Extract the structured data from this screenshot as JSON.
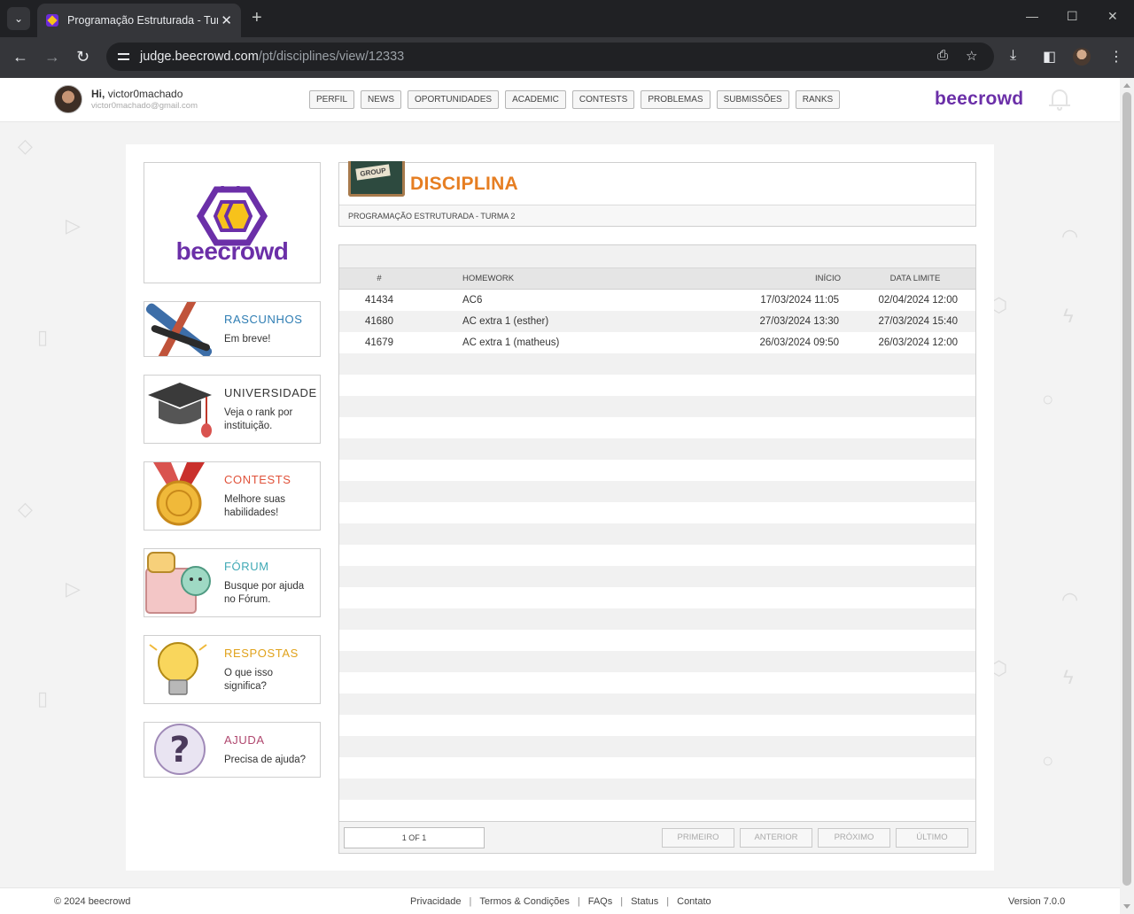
{
  "browser": {
    "tab_title": "Programação Estruturada - Turma 2",
    "url_host": "judge.beecrowd.com",
    "url_path": "/pt/disciplines/view/12333"
  },
  "header": {
    "greeting": "Hi,",
    "username": "victor0machado",
    "email": "victor0machado@gmail.com",
    "nav": [
      "PERFIL",
      "NEWS",
      "OPORTUNIDADES",
      "ACADEMIC",
      "CONTESTS",
      "PROBLEMAS",
      "SUBMISSÕES",
      "RANKS"
    ],
    "brand": "beecrowd"
  },
  "sidebar": {
    "logo_text": "beecrowd",
    "cards": [
      {
        "title": "RASCUNHOS",
        "desc": "Em breve!",
        "color": "#2e7db3"
      },
      {
        "title": "UNIVERSIDADE",
        "desc": "Veja o rank por instituição.",
        "color": "#333333"
      },
      {
        "title": "CONTESTS",
        "desc": "Melhore suas habilidades!",
        "color": "#e0523a"
      },
      {
        "title": "FÓRUM",
        "desc": "Busque por ajuda no Fórum.",
        "color": "#3fa9b5"
      },
      {
        "title": "RESPOSTAS",
        "desc": "O que isso significa?",
        "color": "#e0a21b"
      },
      {
        "title": "AJUDA",
        "desc": "Precisa de ajuda?",
        "color": "#b0486f"
      }
    ]
  },
  "discipline": {
    "board_label": "GROUP",
    "heading": "DISCIPLINA",
    "subtitle": "PROGRAMAÇÃO ESTRUTURADA - TURMA 2"
  },
  "table": {
    "headers": {
      "id": "#",
      "homework": "HOMEWORK",
      "start": "INÍCIO",
      "deadline": "DATA LIMITE"
    },
    "rows": [
      {
        "id": "41434",
        "homework": "AC6",
        "start": "17/03/2024 11:05",
        "deadline": "02/04/2024 12:00"
      },
      {
        "id": "41680",
        "homework": "AC extra 1 (esther)",
        "start": "27/03/2024 13:30",
        "deadline": "27/03/2024 15:40"
      },
      {
        "id": "41679",
        "homework": "AC extra 1 (matheus)",
        "start": "26/03/2024 09:50",
        "deadline": "26/03/2024 12:00"
      }
    ]
  },
  "pagination": {
    "indicator": "1 OF 1",
    "first": "PRIMEIRO",
    "prev": "ANTERIOR",
    "next": "PRÓXIMO",
    "last": "ÚLTIMO"
  },
  "footer": {
    "copyright": "© 2024 beecrowd",
    "links": [
      "Privacidade",
      "Termos & Condições",
      "FAQs",
      "Status",
      "Contato"
    ],
    "version": "Version 7.0.0"
  }
}
